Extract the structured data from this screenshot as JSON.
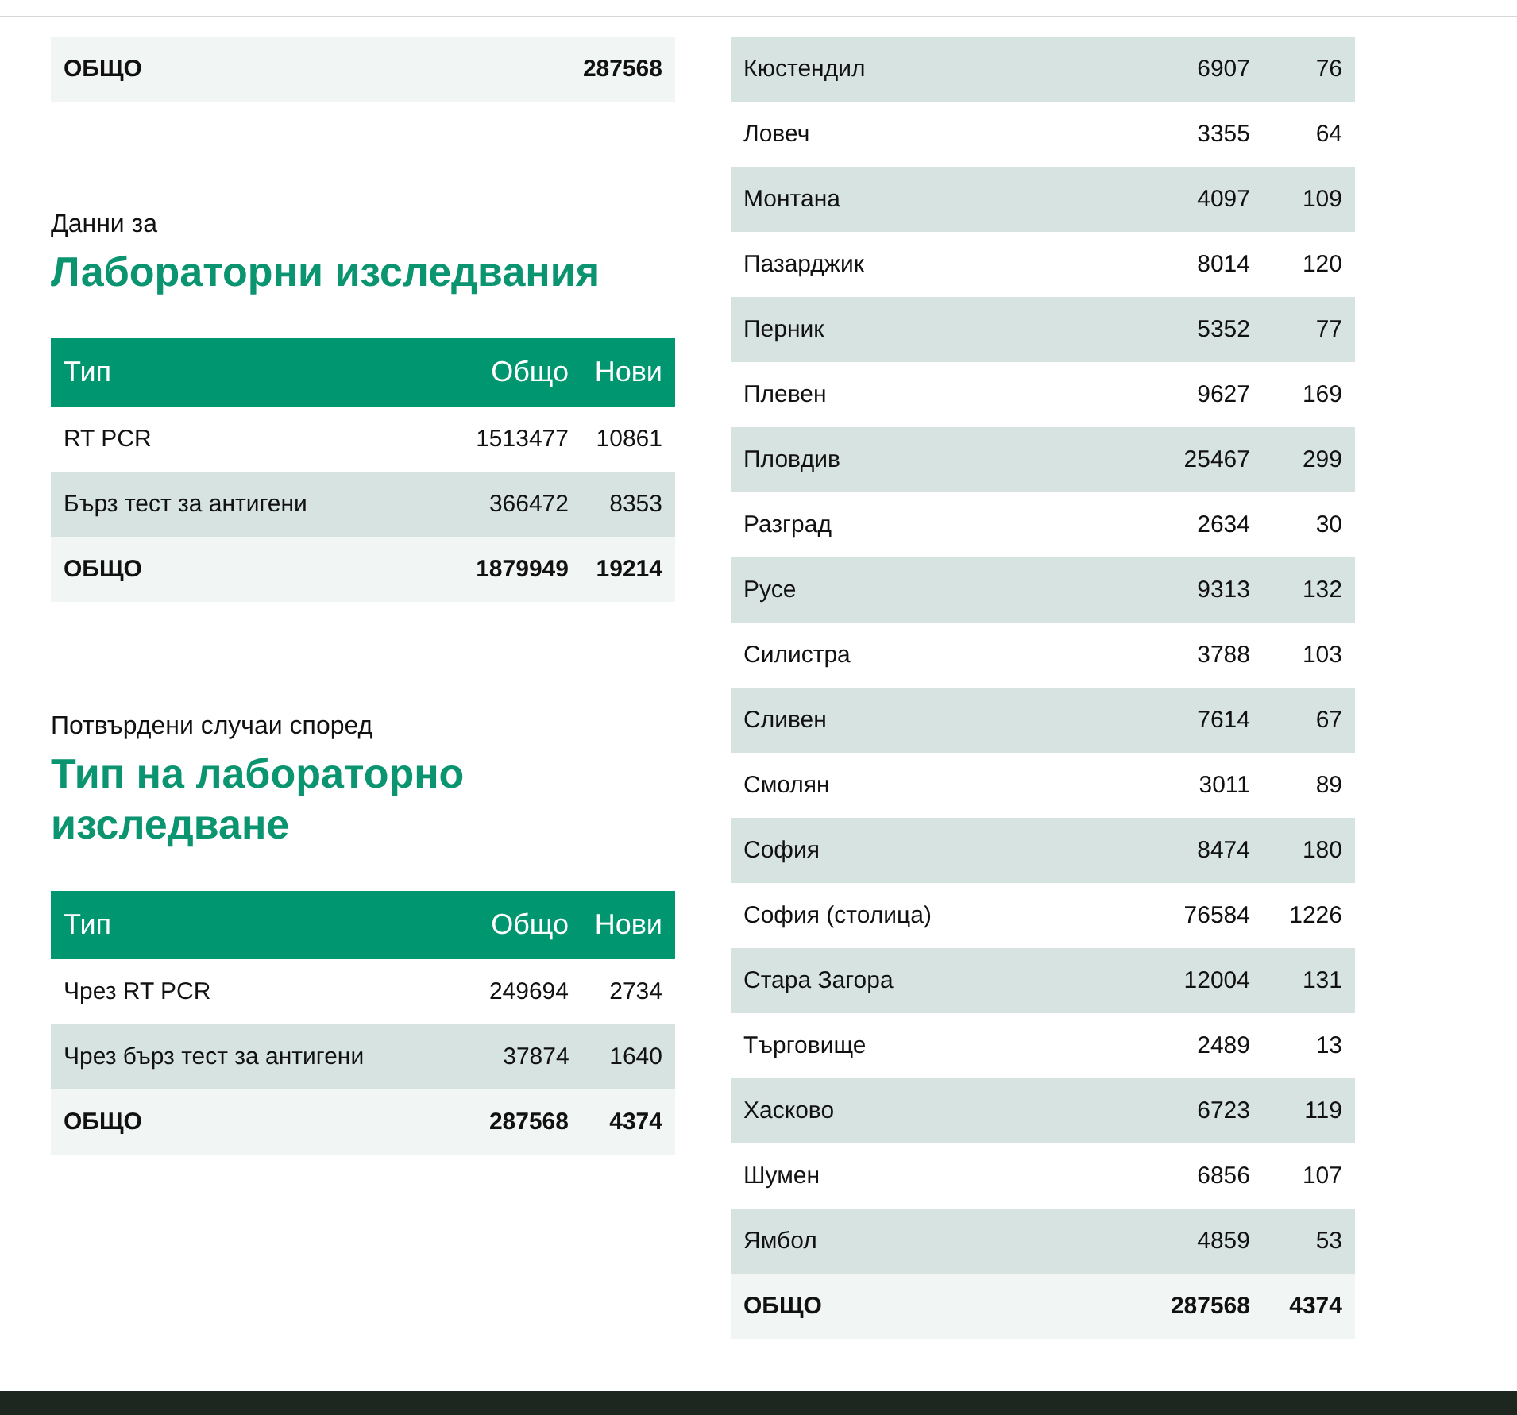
{
  "top_total": {
    "label": "ОБЩО",
    "total": "287568"
  },
  "sections": [
    {
      "intro": "Данни за",
      "title": "Лабораторни изследвания",
      "columns": [
        "Тип",
        "Общо",
        "Нови"
      ],
      "rows": [
        {
          "name": "RT PCR",
          "total": "1513477",
          "new": "10861",
          "highlighted": false
        },
        {
          "name": "Бърз тест за антигени",
          "total": "366472",
          "new": "8353",
          "highlighted": true
        }
      ],
      "total": {
        "label": "ОБЩО",
        "total": "1879949",
        "new": "19214"
      }
    },
    {
      "intro": "Потвърдени случаи според",
      "title": "Тип на лабораторно изследване",
      "columns": [
        "Тип",
        "Общо",
        "Нови"
      ],
      "rows": [
        {
          "name": "Чрез RT PCR",
          "total": "249694",
          "new": "2734",
          "highlighted": false
        },
        {
          "name": "Чрез бърз тест за антигени",
          "total": "37874",
          "new": "1640",
          "highlighted": true
        }
      ],
      "total": {
        "label": "ОБЩО",
        "total": "287568",
        "new": "4374"
      }
    }
  ],
  "regions": {
    "rows": [
      {
        "name": "Кюстендил",
        "total": "6907",
        "new": "76",
        "highlighted": true
      },
      {
        "name": "Ловеч",
        "total": "3355",
        "new": "64",
        "highlighted": false
      },
      {
        "name": "Монтана",
        "total": "4097",
        "new": "109",
        "highlighted": true
      },
      {
        "name": "Пазарджик",
        "total": "8014",
        "new": "120",
        "highlighted": false
      },
      {
        "name": "Перник",
        "total": "5352",
        "new": "77",
        "highlighted": true
      },
      {
        "name": "Плевен",
        "total": "9627",
        "new": "169",
        "highlighted": false
      },
      {
        "name": "Пловдив",
        "total": "25467",
        "new": "299",
        "highlighted": true
      },
      {
        "name": "Разград",
        "total": "2634",
        "new": "30",
        "highlighted": false
      },
      {
        "name": "Русе",
        "total": "9313",
        "new": "132",
        "highlighted": true
      },
      {
        "name": "Силистра",
        "total": "3788",
        "new": "103",
        "highlighted": false
      },
      {
        "name": "Сливен",
        "total": "7614",
        "new": "67",
        "highlighted": true
      },
      {
        "name": "Смолян",
        "total": "3011",
        "new": "89",
        "highlighted": false
      },
      {
        "name": "София",
        "total": "8474",
        "new": "180",
        "highlighted": true
      },
      {
        "name": "София (столица)",
        "total": "76584",
        "new": "1226",
        "highlighted": false
      },
      {
        "name": "Стара Загора",
        "total": "12004",
        "new": "131",
        "highlighted": true
      },
      {
        "name": "Търговище",
        "total": "2489",
        "new": "13",
        "highlighted": false
      },
      {
        "name": "Хасково",
        "total": "6723",
        "new": "119",
        "highlighted": true
      },
      {
        "name": "Шумен",
        "total": "6856",
        "new": "107",
        "highlighted": false
      },
      {
        "name": "Ямбол",
        "total": "4859",
        "new": "53",
        "highlighted": true
      }
    ],
    "total": {
      "label": "ОБЩО",
      "total": "287568",
      "new": "4374"
    }
  }
}
